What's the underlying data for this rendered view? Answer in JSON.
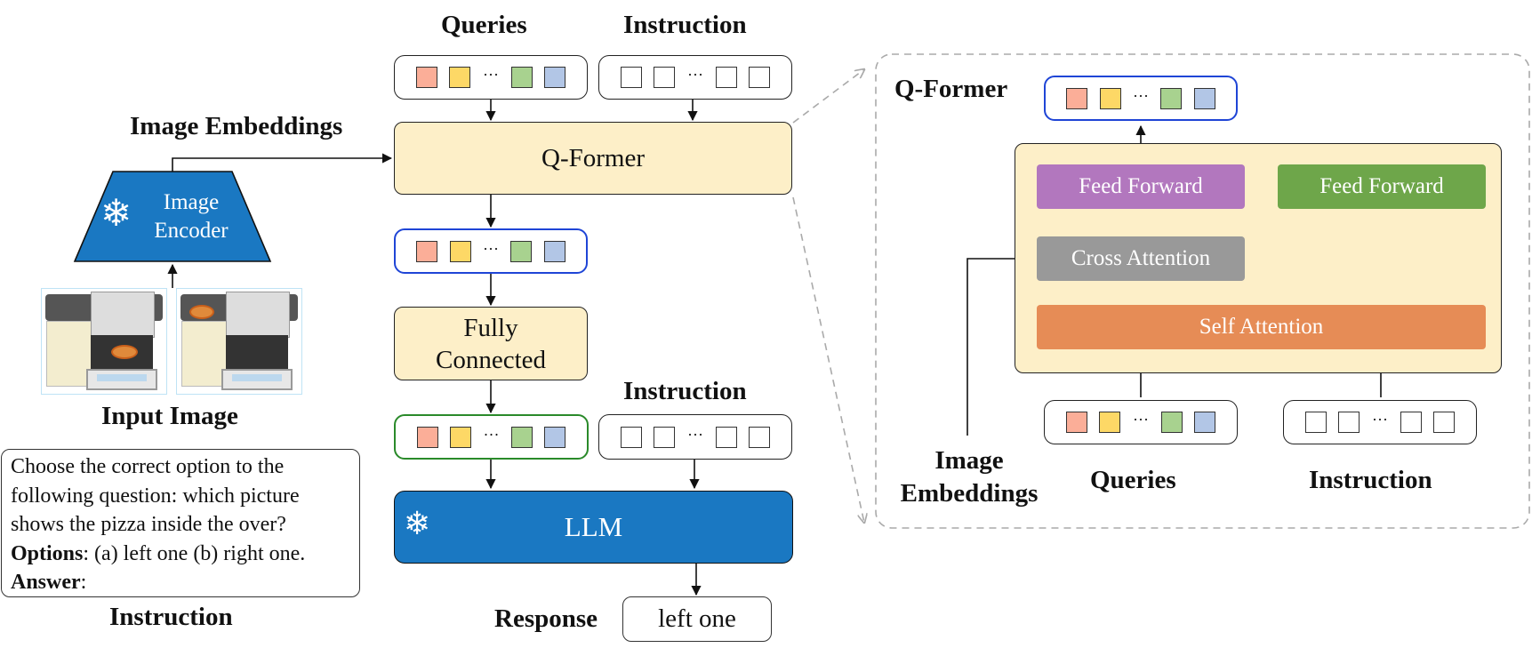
{
  "colors": {
    "query_red": "#fbae98",
    "query_yellow": "#fdd866",
    "query_green": "#a8d28f",
    "query_blue": "#b2c6e6",
    "encoder_blue": "#1a78c2",
    "cream": "#fdefc8",
    "feed_forward_purple": "#b277be",
    "feed_forward_green": "#6ea64a",
    "cross_attention_gray": "#999999",
    "self_attention_orange": "#e68c56",
    "queries_out_border": "#1f45d6",
    "fc_out_border": "#2a8a2a"
  },
  "left": {
    "image_embeddings_label": "Image Embeddings",
    "encoder_label_line1": "Image",
    "encoder_label_line2": "Encoder",
    "input_image_label": "Input Image",
    "instruction_lines": [
      {
        "text": "Choose the correct option to the"
      },
      {
        "text": "following question: which picture"
      },
      {
        "text": "shows the pizza inside the over?"
      },
      {
        "bold": "Options",
        "text": ": (a) left one (b) right one."
      },
      {
        "bold": "Answer",
        "text": ":"
      }
    ],
    "instruction_caption": "Instruction"
  },
  "middle": {
    "queries_label": "Queries",
    "instruction_label_top": "Instruction",
    "qformer_label": "Q-Former",
    "fc_line1": "Fully",
    "fc_line2": "Connected",
    "instruction_label_bottom": "Instruction",
    "llm_label": "LLM",
    "response_label": "Response",
    "response_value": "left one",
    "ellipsis": "···"
  },
  "right": {
    "title": "Q-Former",
    "feed_forward_left": "Feed Forward",
    "feed_forward_right": "Feed Forward",
    "cross_attention": "Cross Attention",
    "self_attention": "Self Attention",
    "image_embeddings_line1": "Image",
    "image_embeddings_line2": "Embeddings",
    "queries_label": "Queries",
    "instruction_label": "Instruction"
  }
}
